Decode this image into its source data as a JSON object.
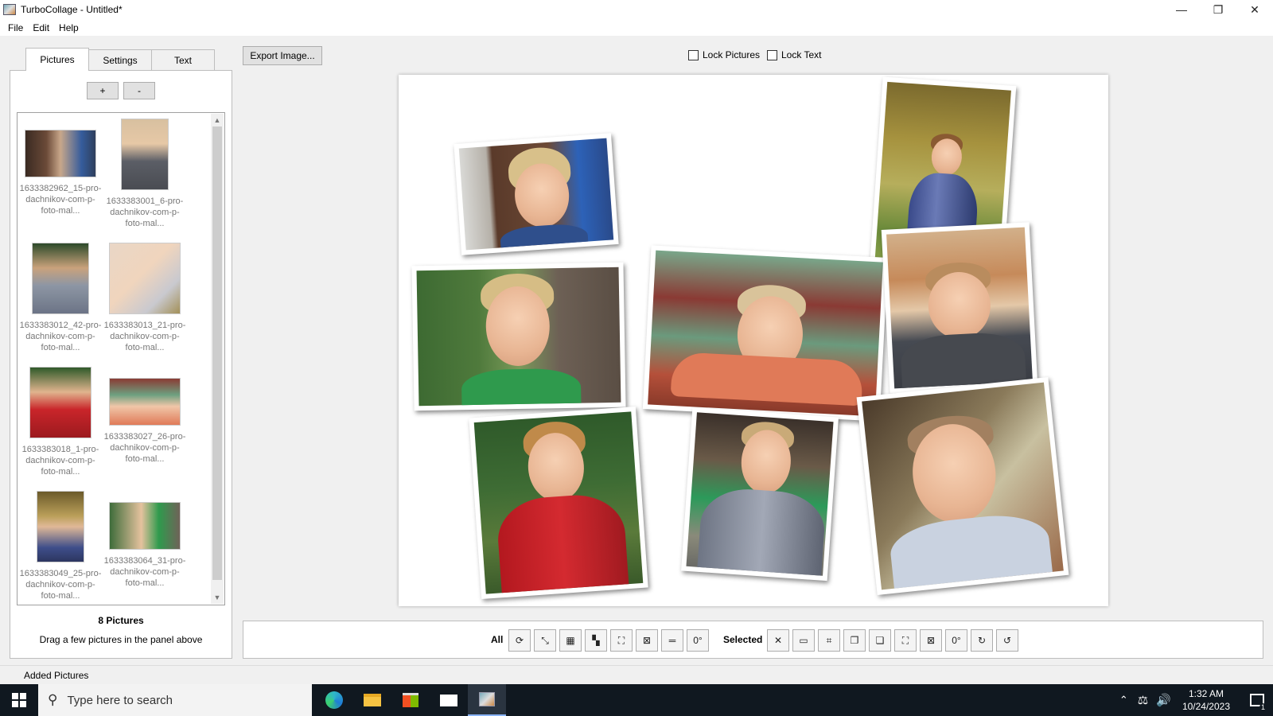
{
  "window": {
    "title": "TurboCollage - Untitled*",
    "controls": [
      "minimize",
      "restore",
      "close"
    ]
  },
  "menu": [
    "File",
    "Edit",
    "Help"
  ],
  "tabs": [
    {
      "label": "Pictures",
      "active": true
    },
    {
      "label": "Settings",
      "active": false
    },
    {
      "label": "Text",
      "active": false
    }
  ],
  "left_panel": {
    "add_label": "+",
    "remove_label": "-",
    "thumbnails": [
      {
        "name": "1633382962_15-pro-dachnikov-com-p-foto-mal..."
      },
      {
        "name": "1633383001_6-pro-dachnikov-com-p-foto-mal..."
      },
      {
        "name": "1633383012_42-pro-dachnikov-com-p-foto-mal..."
      },
      {
        "name": "1633383013_21-pro-dachnikov-com-p-foto-mal..."
      },
      {
        "name": "1633383018_1-pro-dachnikov-com-p-foto-mal..."
      },
      {
        "name": "1633383027_26-pro-dachnikov-com-p-foto-mal..."
      },
      {
        "name": "1633383049_25-pro-dachnikov-com-p-foto-mal..."
      },
      {
        "name": "1633383064_31-pro-dachnikov-com-p-foto-mal..."
      }
    ],
    "count_label": "8 Pictures",
    "hint": "Drag a few pictures in the panel above"
  },
  "toolbar": {
    "export_label": "Export Image...",
    "lock_pictures": {
      "label": "Lock Pictures",
      "checked": false
    },
    "lock_text": {
      "label": "Lock Text",
      "checked": false
    }
  },
  "bottom_toolbar": {
    "all_label": "All",
    "selected_label": "Selected",
    "all_buttons": [
      {
        "icon": "shuffle-icon",
        "glyph": "⟳"
      },
      {
        "icon": "fit-diagonal-icon",
        "glyph": "⤡"
      },
      {
        "icon": "grid-icon",
        "glyph": "▦"
      },
      {
        "icon": "mosaic-icon",
        "glyph": "▚"
      },
      {
        "icon": "expand-icon",
        "glyph": "⛶"
      },
      {
        "icon": "shrink-icon",
        "glyph": "⊠"
      },
      {
        "icon": "equal-size-icon",
        "glyph": "═"
      },
      {
        "icon": "rotate-zero-icon",
        "glyph": "0°"
      }
    ],
    "selected_buttons": [
      {
        "icon": "delete-icon",
        "glyph": "✕"
      },
      {
        "icon": "replace-image-icon",
        "glyph": "▭"
      },
      {
        "icon": "crop-icon",
        "glyph": "⌗"
      },
      {
        "icon": "bring-forward-icon",
        "glyph": "❐"
      },
      {
        "icon": "send-backward-icon",
        "glyph": "❏"
      },
      {
        "icon": "expand-selected-icon",
        "glyph": "⛶"
      },
      {
        "icon": "shrink-selected-icon",
        "glyph": "⊠"
      },
      {
        "icon": "rotate-zero-selected-icon",
        "glyph": "0°"
      },
      {
        "icon": "rotate-cw-icon",
        "glyph": "↻"
      },
      {
        "icon": "rotate-ccw-icon",
        "glyph": "↺"
      }
    ]
  },
  "status": "Added Pictures",
  "taskbar": {
    "search_placeholder": "Type here to search",
    "time": "1:32 AM",
    "date": "10/24/2023",
    "notification_count": "1"
  }
}
